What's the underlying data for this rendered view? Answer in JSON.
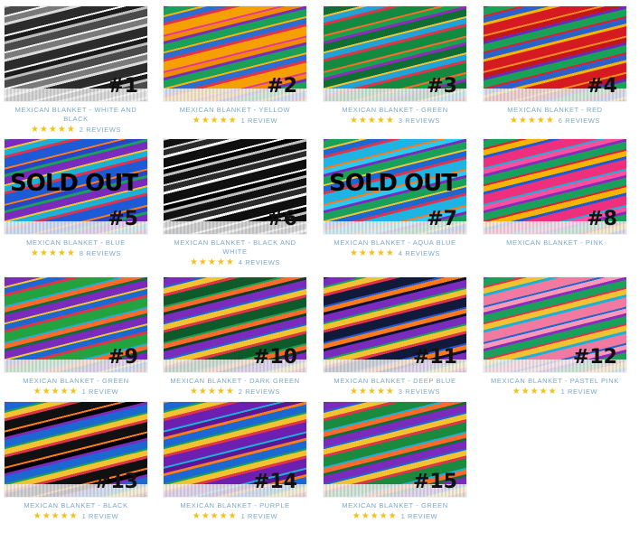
{
  "products": [
    {
      "num": "#1",
      "title": "MEXICAN BLANKET - WHITE AND BLACK",
      "stars": "★★★★★",
      "reviews": "2 REVIEWS",
      "sold_out": "",
      "colors": [
        "#2b2b2b",
        "#dcdcdc",
        "#7a7a7a",
        "#efefef",
        "#4a4a4a",
        "#bdbdbd",
        "#1b1b1b",
        "#f5f5f5"
      ]
    },
    {
      "num": "#2",
      "title": "MEXICAN BLANKET - YELLOW",
      "stars": "★★★★★",
      "reviews": "1 REVIEW",
      "sold_out": "",
      "colors": [
        "#f5a000",
        "#e5324c",
        "#2c6dd1",
        "#f7b500",
        "#19a15b",
        "#7a2bb8",
        "#f08a00",
        "#e33a9c"
      ]
    },
    {
      "num": "#3",
      "title": "MEXICAN BLANKET - GREEN",
      "stars": "★★★★★",
      "reviews": "3 REVIEWS",
      "sold_out": "",
      "colors": [
        "#138a3f",
        "#e0344a",
        "#1ea3d9",
        "#f2c230",
        "#0f6e35",
        "#8d2bbd",
        "#1aa24a",
        "#ff6a2b"
      ]
    },
    {
      "num": "#4",
      "title": "MEXICAN BLANKET - RED",
      "stars": "★★★★★",
      "reviews": "6 REVIEWS",
      "sold_out": "",
      "colors": [
        "#d61a22",
        "#f5b400",
        "#2a62cc",
        "#e21e2a",
        "#18a257",
        "#6b2bb8",
        "#c4141c",
        "#ff8c1a"
      ]
    },
    {
      "num": "#5",
      "title": "MEXICAN BLANKET - BLUE",
      "stars": "★★★★★",
      "reviews": "8 REVIEWS",
      "sold_out": "SOLD OUT",
      "colors": [
        "#1d5bd6",
        "#e1324d",
        "#1bb0d8",
        "#f2c230",
        "#7a2bbd",
        "#19a05a",
        "#2a44c9",
        "#ff7a1a"
      ]
    },
    {
      "num": "#6",
      "title": "MEXICAN BLANKET - BLACK AND WHITE",
      "stars": "★★★★★",
      "reviews": "4 REVIEWS",
      "sold_out": "",
      "colors": [
        "#0f0f0f",
        "#f2f2f2",
        "#2b2b2b",
        "#d6d6d6",
        "#111111",
        "#bfbfbf",
        "#000000",
        "#ffffff"
      ]
    },
    {
      "num": "#7",
      "title": "MEXICAN BLANKET - AQUA BLUE",
      "stars": "★★★★★",
      "reviews": "4 REVIEWS",
      "sold_out": "SOLD OUT",
      "colors": [
        "#1fb3e3",
        "#e0344a",
        "#1c68d3",
        "#f2c230",
        "#19a05a",
        "#7a2bbd",
        "#2bc8f0",
        "#ff7a1a"
      ]
    },
    {
      "num": "#8",
      "title": "MEXICAN BLANKET - PINK",
      "stars": "",
      "reviews": "",
      "sold_out": "",
      "colors": [
        "#ee2f7b",
        "#1d5bd6",
        "#f5b400",
        "#e21e2a",
        "#19a05a",
        "#8a2bbd",
        "#ff4fa0",
        "#1bb0d8"
      ]
    },
    {
      "num": "#9",
      "title": "MEXICAN BLANKET - GREEN",
      "stars": "★★★★★",
      "reviews": "1 REVIEW",
      "sold_out": "",
      "colors": [
        "#23a33f",
        "#e0344a",
        "#1c68d3",
        "#f2c230",
        "#7a2bbd",
        "#0f6e35",
        "#ff6a2b",
        "#1bb0d8"
      ]
    },
    {
      "num": "#10",
      "title": "MEXICAN BLANKET - DARK GREEN",
      "stars": "★★★★★",
      "reviews": "2 REVIEWS",
      "sold_out": "",
      "colors": [
        "#0f5a2a",
        "#e0344a",
        "#f2c230",
        "#1c68d3",
        "#7a2bbd",
        "#0b3f1e",
        "#ff6a2b",
        "#18a257"
      ]
    },
    {
      "num": "#11",
      "title": "MEXICAN BLANKET - DEEP BLUE",
      "stars": "★★★★★",
      "reviews": "3 REVIEWS",
      "sold_out": "",
      "colors": [
        "#111a3a",
        "#e0344a",
        "#f2c230",
        "#19a05a",
        "#7a2bbd",
        "#0c1430",
        "#ff7a1a",
        "#1d5bd6"
      ]
    },
    {
      "num": "#12",
      "title": "MEXICAN BLANKET - PASTEL PINK",
      "stars": "★★★★★",
      "reviews": "1 REVIEW",
      "sold_out": "",
      "colors": [
        "#f27aa0",
        "#1bb0d8",
        "#f2c230",
        "#e0344a",
        "#19a05a",
        "#8a2bbd",
        "#ff98b8",
        "#1c68d3"
      ]
    },
    {
      "num": "#13",
      "title": "MEXICAN BLANKET - BLACK",
      "stars": "★★★★★",
      "reviews": "1 REVIEW",
      "sold_out": "",
      "colors": [
        "#111111",
        "#e0344a",
        "#f2c230",
        "#19a05a",
        "#1c68d3",
        "#7a2bbd",
        "#000000",
        "#ff7a1a"
      ]
    },
    {
      "num": "#14",
      "title": "MEXICAN BLANKET - PURPLE",
      "stars": "★★★★★",
      "reviews": "1 REVIEW",
      "sold_out": "",
      "colors": [
        "#6d1fb2",
        "#e0344a",
        "#f2c230",
        "#19a05a",
        "#1c68d3",
        "#ff7a1a",
        "#5a1697",
        "#1bb0d8"
      ]
    },
    {
      "num": "#15",
      "title": "MEXICAN BLANKET - GREEN",
      "stars": "★★★★★",
      "reviews": "1 REVIEW",
      "sold_out": "",
      "colors": [
        "#1a8a3f",
        "#e0344a",
        "#f2c230",
        "#1c68d3",
        "#7a2bbd",
        "#0f6e35",
        "#ff6a2b",
        "#1bb0d8"
      ]
    }
  ]
}
